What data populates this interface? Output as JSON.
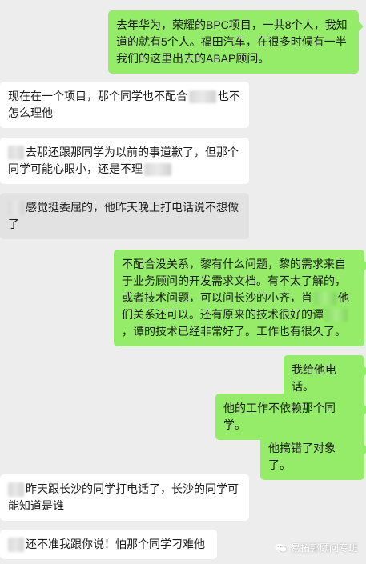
{
  "messages": [
    {
      "side": "out",
      "text": "去年华为，荣耀的BPC项目，一共8个人，我知道的就有5个人。福田汽车，在很多时候有一半我们的这里出去的ABAP顾问。"
    },
    {
      "side": "in",
      "pre": "现在在一个项目，那个同学也不配合",
      "post": "也不怎么理他"
    },
    {
      "side": "in",
      "pre": "去那还跟那同学为以前的事道歉了，但那个同学可能心眼小，还是不理",
      "post": ""
    },
    {
      "side": "in",
      "pre": "感觉挺委屈的，他昨天晚上打电话说不想做了",
      "post": ""
    },
    {
      "side": "out",
      "pre": "不配合没关系，黎有什么问题，黎的需求来自于业务顾问的开发需求文档。有不太了解的，或者技术问题，可以问长沙的小齐，肖",
      "mid": "他们关系还可以。还有原来的技术很好的谭",
      "post": "，谭的技术已经非常好了。工作也有很久了。"
    },
    {
      "side": "out",
      "text": "我给他电话。"
    },
    {
      "side": "out",
      "text": "他的工作不依赖那个同学。"
    },
    {
      "side": "out",
      "text": "他搞错了对象了。"
    },
    {
      "side": "in",
      "pre": "昨天跟长沙的同学打电话了，长沙的同学可能知道是谁",
      "post": ""
    },
    {
      "side": "in",
      "pre": "还不准我跟你说！怕那个同学刁难他",
      "post": ""
    }
  ],
  "watermark": {
    "text": "易拓郭顾问专班",
    "icon": "wechat-icon"
  },
  "colors": {
    "background": "#ededed",
    "outgoing": "#95ec69",
    "incoming": "#ffffff"
  }
}
